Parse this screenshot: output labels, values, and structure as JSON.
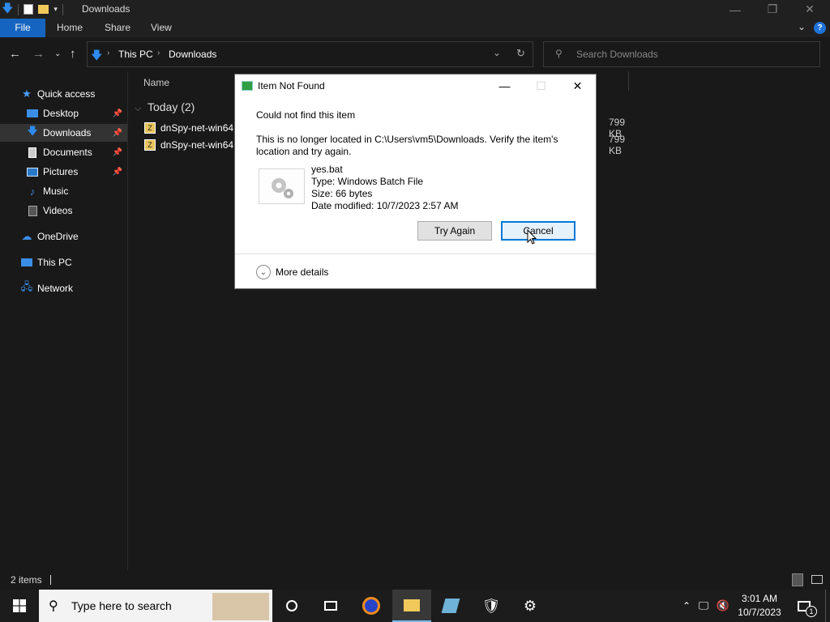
{
  "window": {
    "title": "Downloads",
    "controls": {
      "minimize": "—",
      "restore": "❐",
      "close": "✕"
    }
  },
  "ribbon": {
    "tabs": [
      "File",
      "Home",
      "Share",
      "View"
    ],
    "expand_icon": "chevron-down-icon",
    "help": "?"
  },
  "address": {
    "crumbs": [
      "This PC",
      "Downloads"
    ],
    "search_placeholder": "Search Downloads"
  },
  "nav": {
    "items": [
      {
        "label": "Quick access",
        "icon": "star-icon"
      },
      {
        "label": "Desktop",
        "icon": "desktop-icon",
        "pinned": true
      },
      {
        "label": "Downloads",
        "icon": "download-icon",
        "pinned": true,
        "selected": true
      },
      {
        "label": "Documents",
        "icon": "documents-icon",
        "pinned": true
      },
      {
        "label": "Pictures",
        "icon": "pictures-icon",
        "pinned": true
      },
      {
        "label": "Music",
        "icon": "music-icon"
      },
      {
        "label": "Videos",
        "icon": "videos-icon"
      },
      {
        "label": "OneDrive",
        "icon": "cloud-icon"
      },
      {
        "label": "This PC",
        "icon": "pc-icon"
      },
      {
        "label": "Network",
        "icon": "network-icon"
      }
    ]
  },
  "content": {
    "column_name": "Name",
    "group": "Today (2)",
    "files": [
      {
        "name": "dnSpy-net-win64",
        "size": "799 KB"
      },
      {
        "name": "dnSpy-net-win64",
        "size": "799 KB"
      }
    ]
  },
  "status": {
    "items": "2 items"
  },
  "dialog": {
    "title": "Item Not Found",
    "heading": "Could not find this item",
    "message_line1": "This is no longer located in C:\\Users\\vm5\\Downloads. Verify the item's",
    "message_line2": "location and try again.",
    "file_name": "yes.bat",
    "file_type": "Type: Windows Batch File",
    "file_size": "Size: 66 bytes",
    "file_modified": "Date modified: 10/7/2023 2:57 AM",
    "try_again": "Try Again",
    "cancel": "Cancel",
    "more_details": "More details"
  },
  "taskbar": {
    "search_placeholder": "Type here to search",
    "time": "3:01 AM",
    "date": "10/7/2023",
    "notification_count": "1"
  },
  "colors": {
    "accent": "#1565c0",
    "dialog_button_focus": "#0078d7"
  }
}
